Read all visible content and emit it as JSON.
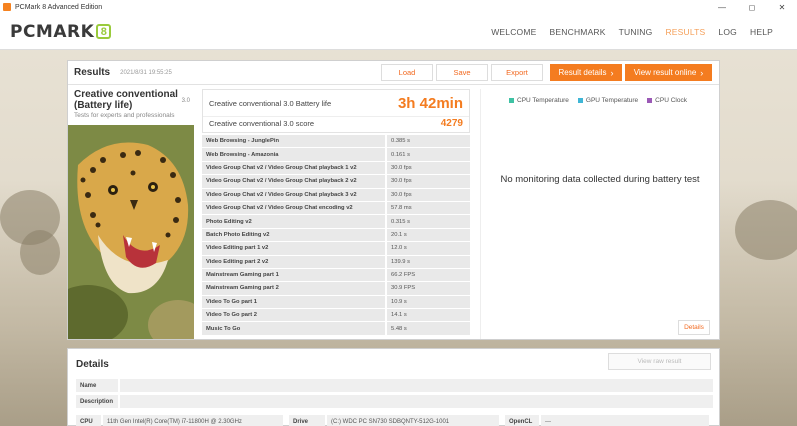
{
  "window": {
    "title": "PCMark 8 Advanced Edition",
    "minimize": "—",
    "maximize": "◻",
    "close": "✕"
  },
  "header": {
    "logo_text": "PCMARK",
    "logo_badge": "8",
    "nav": [
      "WELCOME",
      "BENCHMARK",
      "TUNING",
      "RESULTS",
      "LOG",
      "HELP"
    ],
    "active_nav": "RESULTS"
  },
  "results": {
    "title": "Results",
    "date": "2021/8/31 19:55:25",
    "buttons": {
      "load": "Load",
      "save": "Save",
      "export": "Export",
      "result_details": "Result details",
      "view_online": "View result online"
    },
    "test_name": "Creative conventional (Battery life)",
    "test_version": "3.0",
    "test_description": "Tests for experts and professionals",
    "battery_label": "Creative conventional 3.0 Battery life",
    "battery_value": "3h 42min",
    "score_label": "Creative conventional 3.0 score",
    "score_value": "4279",
    "subscores": [
      {
        "name": "Web Browsing - JunglePin",
        "value": "0.385 s"
      },
      {
        "name": "Web Browsing - Amazonia",
        "value": "0.161 s"
      },
      {
        "name": "Video Group Chat v2 / Video Group Chat playback 1 v2",
        "value": "30.0 fps"
      },
      {
        "name": "Video Group Chat v2 / Video Group Chat playback 2 v2",
        "value": "30.0 fps"
      },
      {
        "name": "Video Group Chat v2 / Video Group Chat playback 3 v2",
        "value": "30.0 fps"
      },
      {
        "name": "Video Group Chat v2 / Video Group Chat encoding v2",
        "value": "57.8 ms"
      },
      {
        "name": "Photo Editing v2",
        "value": "0.315 s"
      },
      {
        "name": "Batch Photo Editing v2",
        "value": "20.1 s"
      },
      {
        "name": "Video Editing part 1 v2",
        "value": "12.0 s"
      },
      {
        "name": "Video Editing part 2 v2",
        "value": "139.9 s"
      },
      {
        "name": "Mainstream Gaming part 1",
        "value": "66.2 FPS"
      },
      {
        "name": "Mainstream Gaming part 2",
        "value": "30.9 FPS"
      },
      {
        "name": "Video To Go part 1",
        "value": "10.9 s"
      },
      {
        "name": "Video To Go part 2",
        "value": "14.1 s"
      },
      {
        "name": "Music To Go",
        "value": "5.48 s"
      }
    ],
    "legend": [
      {
        "label": "CPU Temperature",
        "color": "#3fc2a4"
      },
      {
        "label": "GPU Temperature",
        "color": "#3fb6d6"
      },
      {
        "label": "CPU Clock",
        "color": "#9b59b6"
      }
    ],
    "no_data_message": "No monitoring data collected during battery test",
    "details_button": "Details"
  },
  "details": {
    "title": "Details",
    "view_raw": "View raw result",
    "name_label": "Name",
    "description_label": "Description",
    "cpu_label": "CPU",
    "cpu_value": "11th Gen Intel(R) Core(TM) i7-11800H @ 2.30GHz",
    "drive_label": "Drive",
    "drive_value": "(C:) WDC PC SN730 SDBQNTY-512G-1001",
    "opencl_label": "OpenCL",
    "opencl_value": "---"
  }
}
